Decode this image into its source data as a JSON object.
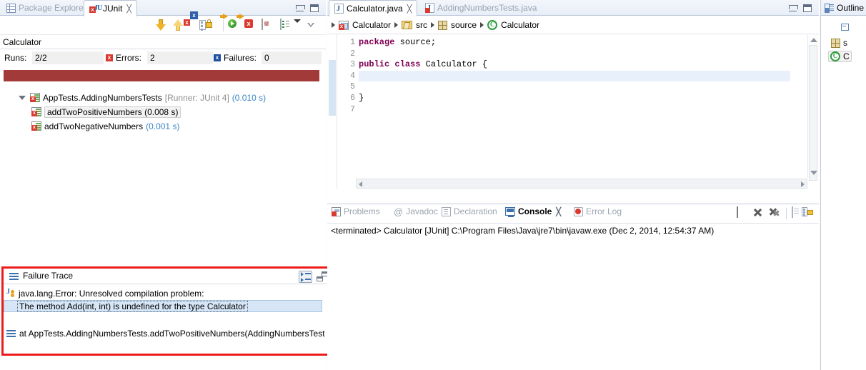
{
  "junit_view": {
    "tabs": [
      {
        "label": "Package Explorer",
        "icon": "package-explorer-icon",
        "active": false
      },
      {
        "label": "JUnit",
        "icon": "junit-icon",
        "active": true,
        "close": "╳"
      }
    ],
    "window_buttons": {
      "minimize": "minimize",
      "maximize": "maximize"
    },
    "toolbar": [
      {
        "name": "next-failure-icon",
        "title": "Next Failure"
      },
      {
        "name": "previous-failure-icon",
        "title": "Previous Failure"
      },
      {
        "name": "show-failures-only-icon",
        "title": "Show Failures Only"
      },
      {
        "name": "scroll-lock-icon",
        "title": "Scroll Lock"
      },
      {
        "name": "rerun-test-icon",
        "title": "Rerun Test"
      },
      {
        "name": "rerun-failed-icon",
        "title": "Rerun Test - Failures First"
      },
      {
        "name": "test-history-icon",
        "title": "Test Run History"
      },
      {
        "name": "view-menu-icon",
        "title": "View Menu"
      },
      {
        "name": "view-chevron-icon",
        "title": "Minimize"
      }
    ],
    "test_name": "Calculator",
    "stats": {
      "runs_label": "Runs:",
      "runs_value": "2/2",
      "errors_label": "Errors:",
      "errors_value": "2",
      "errors_badge": "x",
      "failures_label": "Failures:",
      "failures_value": "0",
      "failures_badge": "x"
    },
    "progress_color": "#a33a3a",
    "tree": [
      {
        "label": "AppTests.AddingNumbersTests",
        "runner": "[Runner: JUnit 4]",
        "time": "(0.010 s)",
        "level": 0,
        "expanded": true,
        "selected": false
      },
      {
        "label": "addTwoPositiveNumbers",
        "runner": "",
        "time": "(0.008 s)",
        "level": 1,
        "expanded": false,
        "selected": true
      },
      {
        "label": "addTwoNegativeNumbers",
        "runner": "",
        "time": "(0.001 s)",
        "level": 1,
        "expanded": false,
        "selected": false
      }
    ]
  },
  "failure_trace": {
    "title": "Failure Trace",
    "annotation_color": "#ee1b1b",
    "buttons": [
      {
        "name": "filter-stack-trace-button",
        "pressed": true
      },
      {
        "name": "restore-view-button",
        "pressed": false
      }
    ],
    "rows": [
      {
        "text": "java.lang.Error: Unresolved compilation problem:",
        "icon": "java-error-icon",
        "selected": false
      },
      {
        "text": "The method Add(int, int) is undefined for the type Calculator",
        "icon": "",
        "selected": true
      },
      {
        "text": "at AppTests.AddingNumbersTests.addTwoPositiveNumbers(AddingNumbersTest",
        "icon": "stack-frame-icon",
        "selected": false
      }
    ]
  },
  "editor": {
    "tabs": [
      {
        "label": "Calculator.java",
        "active": true,
        "close": "╳",
        "icon": "java-file-icon"
      },
      {
        "label": "AddingNumbersTests.java",
        "active": false,
        "close": "",
        "icon": "java-file-error-icon"
      }
    ],
    "window_buttons": {
      "minimize": "minimize",
      "maximize": "maximize"
    },
    "breadcrumb": [
      {
        "label": "Calculator",
        "icon": "java-project-icon"
      },
      {
        "label": "src",
        "icon": "source-folder-icon"
      },
      {
        "label": "source",
        "icon": "package-icon"
      },
      {
        "label": "Calculator",
        "icon": "class-icon"
      }
    ],
    "gutter": [
      "1",
      "2",
      "3",
      "4",
      "5",
      "6",
      "7"
    ],
    "code_lines": [
      {
        "n": 1,
        "segments": [
          {
            "t": "package",
            "c": "kw"
          },
          {
            "t": " source;",
            "c": ""
          }
        ]
      },
      {
        "n": 2,
        "segments": [
          {
            "t": "",
            "c": ""
          }
        ]
      },
      {
        "n": 3,
        "segments": [
          {
            "t": "public",
            "c": "kw"
          },
          {
            "t": " ",
            "c": ""
          },
          {
            "t": "class",
            "c": "kw"
          },
          {
            "t": " Calculator {",
            "c": ""
          }
        ]
      },
      {
        "n": 4,
        "segments": [
          {
            "t": "",
            "c": ""
          }
        ]
      },
      {
        "n": 5,
        "segments": [
          {
            "t": "",
            "c": ""
          }
        ]
      },
      {
        "n": 6,
        "segments": [
          {
            "t": "}",
            "c": ""
          }
        ]
      },
      {
        "n": 7,
        "segments": [
          {
            "t": "",
            "c": ""
          }
        ]
      }
    ],
    "caret_line": 4
  },
  "console": {
    "tabs": [
      {
        "label": "Problems",
        "active": false,
        "icon": "problems-icon"
      },
      {
        "label": "Javadoc",
        "active": false,
        "icon": "javadoc-icon"
      },
      {
        "label": "Declaration",
        "active": false,
        "icon": "declaration-icon"
      },
      {
        "label": "Console",
        "active": true,
        "icon": "console-icon",
        "close": "╳"
      },
      {
        "label": "Error Log",
        "active": false,
        "icon": "error-log-icon"
      }
    ],
    "toolbar": [
      {
        "name": "terminate-button"
      },
      {
        "name": "remove-launch-button"
      },
      {
        "name": "remove-all-terminated-button"
      },
      {
        "name": "clear-console-button"
      },
      {
        "name": "scroll-lock-button"
      },
      {
        "name": "pin-console-button",
        "pressed": true
      },
      {
        "name": "display-selected-console-button",
        "pressed": true
      }
    ],
    "output": "<terminated> Calculator [JUnit] C:\\Program Files\\Java\\jre7\\bin\\javaw.exe (Dec 2, 2014, 12:54:37 AM)"
  },
  "outline": {
    "tab_label": "Outline",
    "rows": [
      {
        "label": "",
        "icon": "collapse-all-icon",
        "selected": false
      },
      {
        "label": "s",
        "icon": "package-icon",
        "selected": false
      },
      {
        "label": "C",
        "icon": "class-icon",
        "selected": true
      }
    ]
  }
}
